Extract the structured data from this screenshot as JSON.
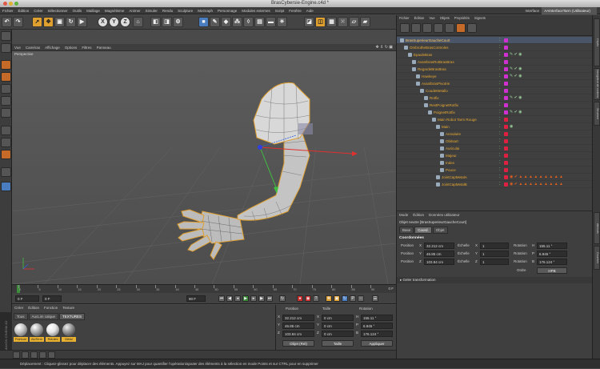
{
  "window": {
    "title": "BrasCybersie-Engine.c4d *"
  },
  "menubar": {
    "items": [
      "Fichier",
      "Édition",
      "Créer",
      "Sélectionner",
      "Outils",
      "Maillage",
      "Magnétisme",
      "Animer",
      "Simuler",
      "Rendu",
      "Sculpture",
      "MoGraph",
      "Personnage",
      "Modules externes",
      "Script",
      "Fenêtre",
      "Aide"
    ],
    "layout_label": "Interface",
    "layout_value": "AAInterfaceTarm (Utilisateur)"
  },
  "viewport": {
    "menu": [
      "Vue",
      "Caméras",
      "Affichage",
      "Options",
      "Filtres",
      "Panneau"
    ],
    "label": "Perspective"
  },
  "timeline": {
    "ticks": [
      "0",
      "5",
      "10",
      "15",
      "20",
      "25",
      "30",
      "35",
      "40",
      "45",
      "50",
      "55",
      "60",
      "65",
      "70",
      "75",
      "80",
      "85",
      "90"
    ],
    "end_label": "0 F",
    "current_frame": "0 F",
    "start_field": "0 F",
    "end_field": "90 F"
  },
  "materials": {
    "menu": [
      "Créer",
      "Édition",
      "Fonction",
      "Texture"
    ],
    "tabs": [
      "Tous",
      "AucLim calque",
      "TEXTURES"
    ],
    "items": [
      {
        "label": "Peinture",
        "color": "#c8c8c8"
      },
      {
        "label": "AluTerm",
        "color": "#b0b0b0"
      },
      {
        "label": "Rotules",
        "color": "#e8e8e8"
      },
      {
        "label": "Métal",
        "color": "#999999"
      }
    ]
  },
  "coordinates": {
    "col_headers": [
      "Position",
      "Taille",
      "Rotation"
    ],
    "rows": [
      {
        "axis": "X",
        "pos": "32.212 cm",
        "size": "0 cm",
        "size_axis": "H",
        "rot": "155.11 °"
      },
      {
        "axis": "Y",
        "pos": "46.85 cm",
        "size": "0 cm",
        "size_axis": "P",
        "rot": "6.945 °"
      },
      {
        "axis": "Z",
        "pos": "103.84 cm",
        "size": "0 cm",
        "size_axis": "B",
        "rot": "176.124 °"
      }
    ],
    "mode_select": "Objet (Rel)",
    "size_select": "Taille",
    "apply_button": "Appliquer"
  },
  "objects": {
    "menu": [
      "Fichier",
      "Édition",
      "Vue",
      "Objets",
      "Propriétés",
      "Signets"
    ],
    "rows": [
      {
        "name": "BrasSuperieurGaucheCourt",
        "indent": 0,
        "selected": true,
        "tag": "#d030d0",
        "tags": ""
      },
      {
        "name": "OmbrotheBrasControles",
        "indent": 1,
        "tag": "#d030d0",
        "tags": ""
      },
      {
        "name": "EpauleBras",
        "indent": 2,
        "tag": "#d030d0",
        "tags": "✎ ✔ ◉"
      },
      {
        "name": "AvantbrasRotBrasBras",
        "indent": 3,
        "tag": "#d030d0",
        "tags": ""
      },
      {
        "name": "RegardeBrasBras",
        "indent": 3,
        "tag": "#d030d0",
        "tags": "✎ ✔ ◉"
      },
      {
        "name": "Hawkeye",
        "indent": 4,
        "tag": "#d030d0",
        "tags": "✎ ✔ ◉"
      },
      {
        "name": "AvantbrasPivotrie",
        "indent": 4,
        "tag": "#d030d0",
        "tags": ""
      },
      {
        "name": "CoudeMetallo",
        "indent": 5,
        "tag": "#d030d0",
        "tags": ""
      },
      {
        "name": "Rotfix",
        "indent": 6,
        "tag": "#d030d0",
        "tags": "✎ ✔ ◉"
      },
      {
        "name": "RestPoignetRotfix",
        "indent": 6,
        "tag": "#d030d0",
        "tags": ""
      },
      {
        "name": "PoignetRotfix",
        "indent": 7,
        "tag": "#d030d0",
        "tags": "✎ ✔ ◉"
      },
      {
        "name": "Main Robot Tarm Rouge",
        "indent": 8,
        "tag": "#e02040",
        "tags": ""
      },
      {
        "name": "Main",
        "indent": 9,
        "tag": "#e02040",
        "tags": "◉"
      },
      {
        "name": "Annulaire",
        "indent": 10,
        "tag": "#e02040",
        "tags": ""
      },
      {
        "name": "Obitsart",
        "indent": 10,
        "tag": "#e02040",
        "tags": ""
      },
      {
        "name": "Auriculai",
        "indent": 10,
        "tag": "#e02040",
        "tags": ""
      },
      {
        "name": "Majeur",
        "indent": 10,
        "tag": "#e02040",
        "tags": ""
      },
      {
        "name": "Index",
        "indent": 10,
        "tag": "#e02040",
        "tags": ""
      },
      {
        "name": "Pouce",
        "indent": 10,
        "tag": "#e02040",
        "tags": ""
      },
      {
        "name": "JointCapMetalA",
        "indent": 9,
        "tag": "#e02040",
        "tags": "◉ ✔ ▲ ▲ ▲ ▲ ▲ ▲ ▲ ▲ ▲"
      },
      {
        "name": "JointCapMetalB",
        "indent": 9,
        "tag": "#e02040",
        "tags": "◉ ✔ ▲ ▲ ▲ ▲ ▲ ▲ ▲ ▲ ▲"
      }
    ]
  },
  "attributes": {
    "menu": [
      "Mode",
      "Édition",
      "Données utilisateur"
    ],
    "object_label": "Objet neutre [BrasSuperieurGaucheCourt]",
    "tabs": [
      "Base",
      "Coord.",
      "Objet"
    ],
    "section": "Coordonnées",
    "rows": [
      {
        "p_label": "Position",
        "p_axis": "X",
        "p_val": "32.212 cm",
        "s_label": "Échelle",
        "s_axis": "X",
        "s_val": "1",
        "r_label": "Rotation",
        "r_axis": "H",
        "r_val": "155.11 °"
      },
      {
        "p_label": "Position",
        "p_axis": "Y",
        "p_val": "46.85 cm",
        "s_label": "Échelle",
        "s_axis": "Y",
        "s_val": "1",
        "r_label": "Rotation",
        "r_axis": "P",
        "r_val": "6.945 °"
      },
      {
        "p_label": "Position",
        "p_axis": "Z",
        "p_val": "103.84 cm",
        "s_label": "Échelle",
        "s_axis": "Z",
        "s_val": "1",
        "r_label": "Rotation",
        "r_axis": "B",
        "r_val": "176.124 °"
      }
    ],
    "order_label": "Ordre",
    "order_value": "HPB",
    "freeze": "▸ Geler transformation"
  },
  "side_tabs": [
    "Objets",
    "Navigateur de contenu",
    "Structure",
    "Attributs",
    "Couches"
  ],
  "statusbar": {
    "text": "Déplacement : Cliquez-glissez pour déplacer des éléments. Appuyez sur MAJ pour quantifier l'opération/ajouter des éléments à la sélection en mode Points et sur CTRL pour en supprimer"
  },
  "colors": {
    "accent": "#e8a830",
    "selection": "#4b5568",
    "tag_magenta": "#d030d0",
    "tag_red": "#e02040"
  }
}
